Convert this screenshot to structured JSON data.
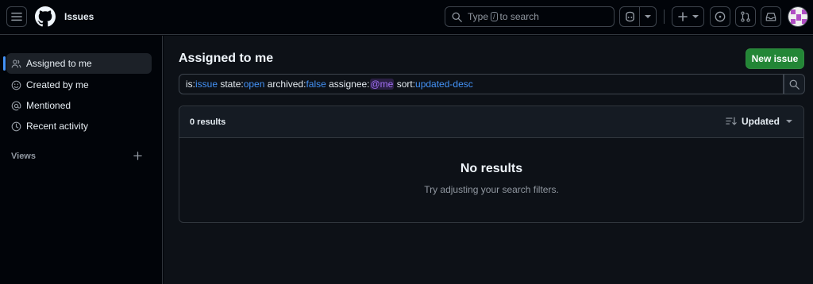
{
  "header": {
    "title": "Issues",
    "search": {
      "prefix": "Type",
      "key": "/",
      "suffix": "to search"
    },
    "icons": [
      "hamburger-menu-icon",
      "github-logo-icon",
      "search-icon",
      "copilot-icon",
      "chevron-down-icon",
      "plus-icon",
      "issue-opened-icon",
      "pull-request-icon",
      "inbox-icon",
      "avatar"
    ]
  },
  "sidebar": {
    "items": [
      {
        "label": "Assigned to me",
        "icon": "people-icon",
        "active": true
      },
      {
        "label": "Created by me",
        "icon": "smiley-icon",
        "active": false
      },
      {
        "label": "Mentioned",
        "icon": "mention-icon",
        "active": false
      },
      {
        "label": "Recent activity",
        "icon": "clock-icon",
        "active": false
      }
    ],
    "views_label": "Views"
  },
  "main": {
    "title": "Assigned to me",
    "new_issue_label": "New issue",
    "query": {
      "is_key": "is:",
      "is_val": "issue",
      "state_key": " state:",
      "state_val": "open",
      "archived_key": " archived:",
      "archived_val": "false",
      "assignee_key": " assignee:",
      "assignee_val": "@me",
      "sort_key": " sort:",
      "sort_val": "updated-desc"
    },
    "results": {
      "count_label": "0 results",
      "sort_label": "Updated",
      "empty_title": "No results",
      "empty_subtitle": "Try adjusting your search filters."
    }
  },
  "colors": {
    "accent": "#4493f8",
    "primary_button": "#238636",
    "mention": "#a371f7",
    "background": "#0d1117"
  }
}
